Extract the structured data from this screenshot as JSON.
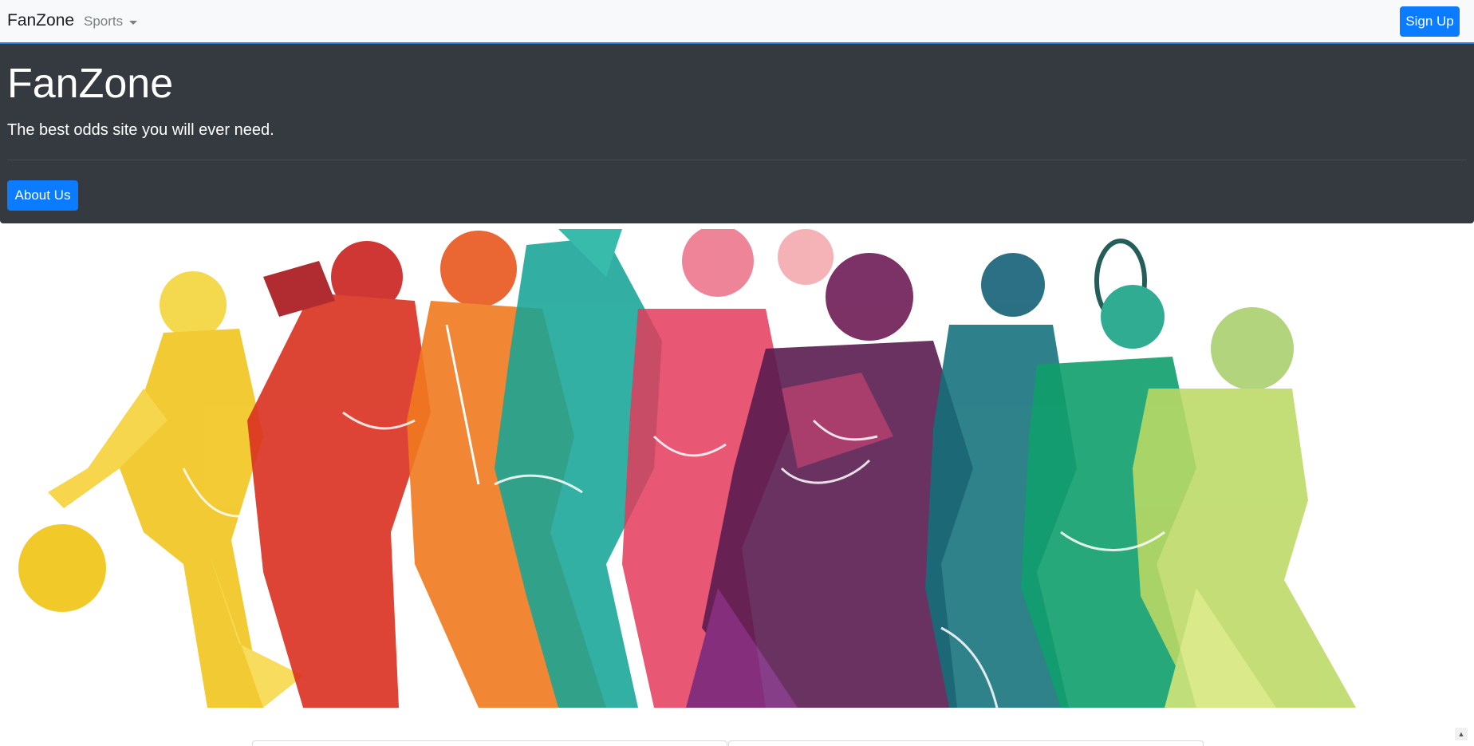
{
  "navbar": {
    "brand": "FanZone",
    "dropdown_label": "Sports",
    "signup_label": "Sign Up"
  },
  "jumbotron": {
    "title": "FanZone",
    "lead": "The best odds site you will ever need.",
    "about_label": "About Us"
  },
  "colors": {
    "primary": "#0b7bff",
    "jumbotron_bg": "#343a40",
    "navbar_bg": "#f8f9fa"
  },
  "icons": {
    "dropdown": "caret-down-icon",
    "scroll": "scroll-up-arrow-icon"
  }
}
